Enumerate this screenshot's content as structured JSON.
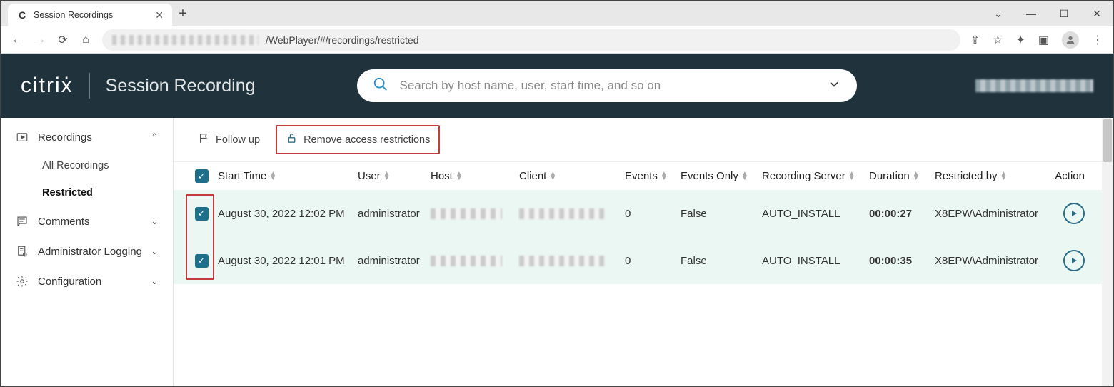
{
  "browser": {
    "tab_title": "Session Recordings",
    "url_visible": "/WebPlayer/#/recordings/restricted"
  },
  "header": {
    "brand": "citrix",
    "app_title": "Session Recording",
    "search_placeholder": "Search by host name, user, start time, and so on"
  },
  "sidebar": {
    "recordings_label": "Recordings",
    "all_recordings_label": "All Recordings",
    "restricted_label": "Restricted",
    "comments_label": "Comments",
    "admin_log_label": "Administrator Logging",
    "config_label": "Configuration"
  },
  "toolbar": {
    "followup_label": "Follow up",
    "remove_label": "Remove access restrictions"
  },
  "columns": {
    "start": "Start Time",
    "user": "User",
    "host": "Host",
    "client": "Client",
    "events": "Events",
    "events_only": "Events Only",
    "server": "Recording Server",
    "duration": "Duration",
    "restricted_by": "Restricted by",
    "action": "Action"
  },
  "rows": [
    {
      "start": "August 30, 2022 12:02 PM",
      "user": "administrator",
      "events": "0",
      "events_only": "False",
      "server": "AUTO_INSTALL",
      "duration": "00:00:27",
      "restricted_by": "X8EPW\\Administrator"
    },
    {
      "start": "August 30, 2022 12:01 PM",
      "user": "administrator",
      "events": "0",
      "events_only": "False",
      "server": "AUTO_INSTALL",
      "duration": "00:00:35",
      "restricted_by": "X8EPW\\Administrator"
    }
  ]
}
